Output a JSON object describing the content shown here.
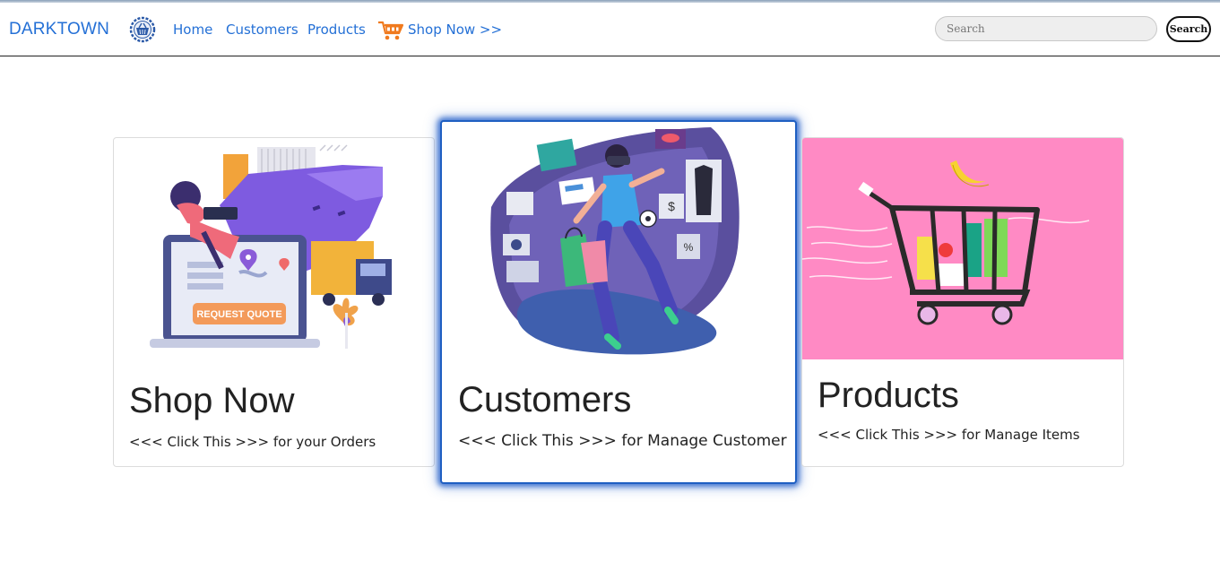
{
  "navbar": {
    "brand": "DARKTOWN",
    "links": [
      "Home",
      "Customers",
      "Products",
      "Shop Now >>"
    ],
    "search_placeholder": "Search",
    "search_button": "Search",
    "accent_color": "#2470d6"
  },
  "cards": [
    {
      "title": "Shop Now",
      "text": "<<< Click This >>> for your Orders",
      "image": "request-quote-illustration"
    },
    {
      "title": "Customers",
      "text": "<<< Click This >>> for Manage Customer",
      "image": "vr-shopping-illustration",
      "active": true
    },
    {
      "title": "Products",
      "text": "<<< Click This >>> for Manage Items",
      "image": "shopping-cart-illustration",
      "image_bg": "#ff8ac4"
    }
  ],
  "illustration_text": {
    "request_quote": "REQUEST QUOTE"
  },
  "icons": {
    "logo": "basket-logo-icon",
    "shop": "cart-icon"
  }
}
